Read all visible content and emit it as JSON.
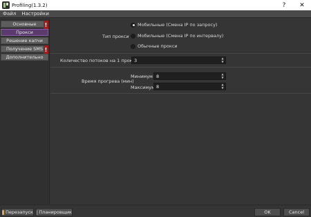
{
  "window": {
    "title": "Profiling(1.3.2)"
  },
  "title_controls": {
    "help": "?",
    "close": "✕"
  },
  "menu": [
    "Файл",
    "Настройки"
  ],
  "sidebar": {
    "items": [
      {
        "label": "Основные",
        "warning": "!"
      },
      {
        "label": "Прокси",
        "active": true
      },
      {
        "label": "Решение капчи"
      },
      {
        "label": "Получение SMS",
        "warning": "!"
      },
      {
        "label": "Дополнительно"
      }
    ]
  },
  "proxy": {
    "type_label": "Тип прокси",
    "options": [
      {
        "label": "Мобильные (Смена IP по запросу)",
        "selected": true
      },
      {
        "label": "Мобильные (Смена IP по интервалу)",
        "selected": false
      },
      {
        "label": "Обычные прокси",
        "selected": false
      }
    ]
  },
  "threads": {
    "label": "Количество потоков на 1 прокси",
    "value": "3"
  },
  "warmup": {
    "label": "Время прогрева (мин)",
    "min_label": "Минимум",
    "min_value": "8",
    "max_label": "Максимум",
    "max_value": "8"
  },
  "bottom": {
    "restart_label": "Перезапуск",
    "scheduler_label": "Планировщик",
    "ok_label": "OK",
    "cancel_label": "Cancel"
  },
  "colors": {
    "warning": "#b01616",
    "active_item": "#5b3a6e",
    "restart_icon": "#e5a84a",
    "scheduler_icon": "#6fb7d9"
  }
}
